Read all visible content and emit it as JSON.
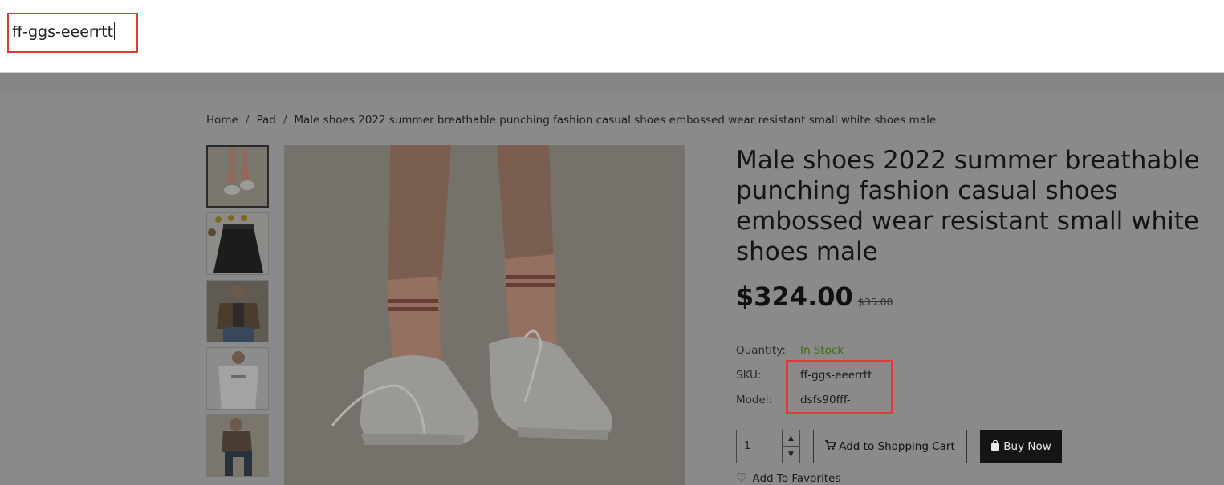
{
  "search": {
    "value": "ff-ggs-eeerrtt"
  },
  "breadcrumb": [
    "Home",
    "Pad",
    "Male shoes 2022 summer breathable punching fashion casual shoes embossed wear resistant small white shoes male"
  ],
  "product": {
    "title": "Male shoes 2022 summer breathable punching fashion casual shoes embossed wear resistant small white shoes male",
    "price": "$324.00",
    "old_price": "$35.00",
    "quantity_label": "Quantity:",
    "stock_status": "In Stock",
    "sku_label": "SKU:",
    "sku": "ff-ggs-eeerrtt",
    "model_label": "Model:",
    "model": "dsfs90fff-"
  },
  "actions": {
    "qty": "1",
    "add_to_cart": "Add to Shopping Cart",
    "buy_now": "Buy Now",
    "add_to_favorites": "Add To Favorites"
  },
  "colors": {
    "highlight": "#e53935",
    "stock": "#3f6d16",
    "overlay": "#8a8a8a"
  },
  "icons": [
    "cart-icon",
    "bag-icon",
    "heart-icon",
    "chevron-up-icon",
    "chevron-down-icon"
  ]
}
